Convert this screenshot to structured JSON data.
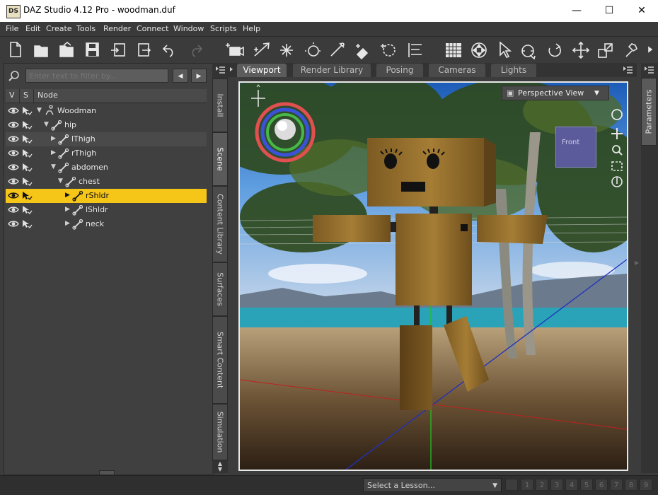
{
  "window": {
    "app_icon": "DS",
    "title": "DAZ Studio 4.12 Pro - woodman.duf",
    "minimize": "—",
    "maximize": "☐",
    "close": "✕"
  },
  "menu": [
    "File",
    "Edit",
    "Create",
    "Tools",
    "Render",
    "Connect",
    "Window",
    "Scripts",
    "Help"
  ],
  "toolbar_icons": [
    "new-file-icon",
    "open-icon",
    "open-folder-icon",
    "save-icon",
    "import-icon",
    "export-icon",
    "undo-icon",
    "redo-icon",
    "add-camera-icon",
    "spotlight-icon",
    "distant-light-icon",
    "point-light-icon",
    "linear-light-icon",
    "surface-tool-icon",
    "node-select-icon",
    "align-icon",
    "render-icon",
    "universal-tool-icon",
    "pointer-icon",
    "rotate-tool-icon",
    "rotate-icon",
    "translate-icon",
    "scale-icon",
    "joint-editor-icon"
  ],
  "scene_panel": {
    "filter_placeholder": "Enter text to filter by...",
    "columns": {
      "v": "V",
      "s": "S",
      "node": "Node"
    },
    "nodes": [
      {
        "label": "Woodman",
        "depth": 0,
        "expanded": true,
        "icon": "figure-icon"
      },
      {
        "label": "hip",
        "depth": 1,
        "expanded": true,
        "icon": "bone-icon"
      },
      {
        "label": "lThigh",
        "depth": 2,
        "expanded": false,
        "icon": "bone-icon"
      },
      {
        "label": "rThigh",
        "depth": 2,
        "expanded": false,
        "icon": "bone-icon"
      },
      {
        "label": "abdomen",
        "depth": 2,
        "expanded": true,
        "icon": "bone-icon"
      },
      {
        "label": "chest",
        "depth": 3,
        "expanded": true,
        "icon": "bone-icon"
      },
      {
        "label": "rShldr",
        "depth": 4,
        "expanded": false,
        "icon": "bone-icon",
        "selected": true
      },
      {
        "label": "lShldr",
        "depth": 4,
        "expanded": false,
        "icon": "bone-icon"
      },
      {
        "label": "neck",
        "depth": 4,
        "expanded": false,
        "icon": "bone-icon"
      }
    ]
  },
  "side_tabs": [
    "Install",
    "Scene",
    "Content Library",
    "Surfaces",
    "Smart Content",
    "Simulation"
  ],
  "active_side_tab": "Scene",
  "view_tabs": [
    "Viewport",
    "Render Library",
    "Posing",
    "Cameras",
    "Lights"
  ],
  "active_view_tab": "Viewport",
  "viewport": {
    "camera": "Perspective View",
    "view_cube_label": "Front"
  },
  "right_tab": "Parameters",
  "bottom": {
    "lesson_placeholder": "Select a Lesson...",
    "pages": [
      "1",
      "2",
      "3",
      "4",
      "5",
      "6",
      "7",
      "8",
      "9"
    ]
  },
  "colors": {
    "selection": "#f5c518",
    "panel": "#404040",
    "background": "#3c3c3c"
  }
}
